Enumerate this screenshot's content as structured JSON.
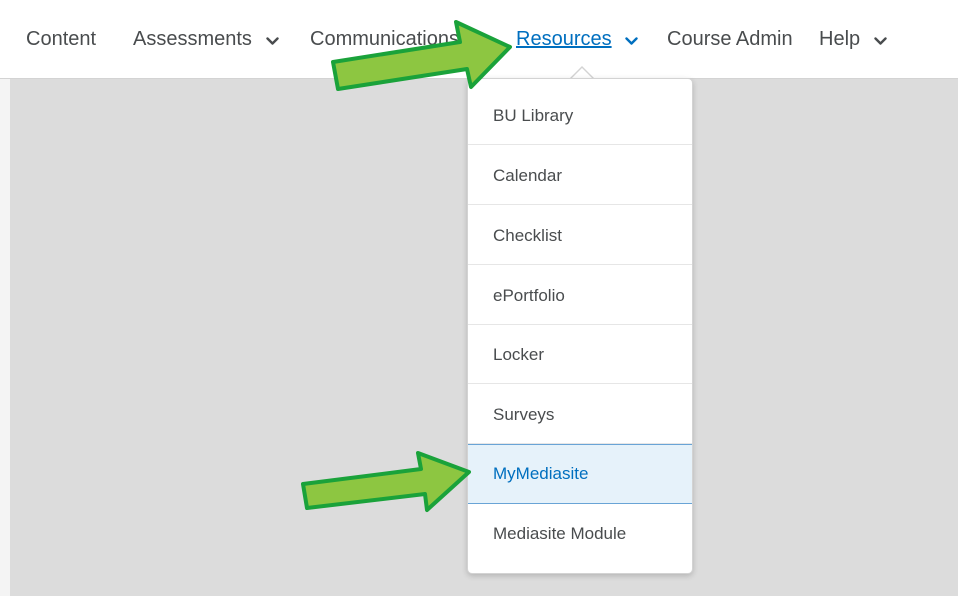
{
  "nav": {
    "items": [
      {
        "label": "Content"
      },
      {
        "label": "Assessments"
      },
      {
        "label": "Communications"
      },
      {
        "label": "Resources"
      },
      {
        "label": "Course Admin"
      },
      {
        "label": "Help"
      }
    ],
    "active_item": "Resources"
  },
  "resources_menu": {
    "items": [
      {
        "label": "BU Library"
      },
      {
        "label": "Calendar"
      },
      {
        "label": "Checklist"
      },
      {
        "label": "ePortfolio"
      },
      {
        "label": "Locker"
      },
      {
        "label": "Surveys"
      },
      {
        "label": "MyMediasite"
      },
      {
        "label": "Mediasite Module"
      }
    ],
    "highlighted_item": "MyMediasite"
  },
  "annotations": {
    "arrow_color": "#8dc641",
    "arrow_outline": "#1aa23a"
  },
  "colors": {
    "active_link": "#006fbf",
    "highlight_bg": "#e6f2fa",
    "page_bg": "#dcdcdc"
  },
  "icons": [
    "chevron-down-icon",
    "green-arrow-annotation"
  ]
}
